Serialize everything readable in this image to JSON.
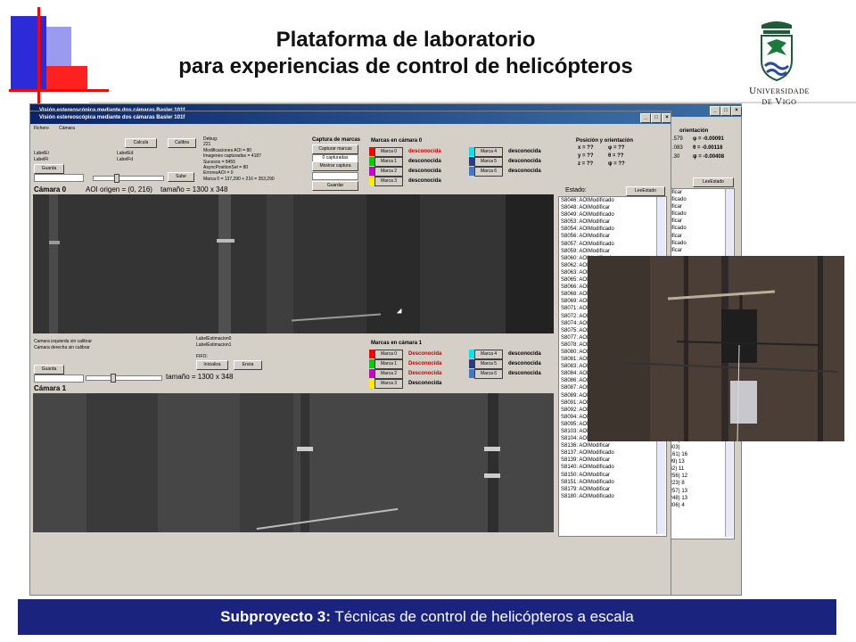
{
  "slide": {
    "title_line1": "Plataforma de laboratorio",
    "title_line2": "para experiencias de control de helicópteros",
    "university_line1": "Universidade",
    "university_line2": "de Vigo",
    "footer_bold": "Subproyecto 3:",
    "footer_text": " Técnicas de control de helicópteros a escala",
    "colors": {
      "footer_bg": "#1a237e",
      "deco_red": "#ff0000",
      "deco_blue": "#2b2bd8"
    }
  },
  "window": {
    "title": "Visión estereoscópica mediante dos cámaras Basler 101f",
    "title_back": "Visión estereoscópica mediante dos cámaras Basler 101f",
    "menu": [
      "Fichero",
      "Cámara"
    ],
    "controls": {
      "minimize": "_",
      "maximize": "□",
      "close": "×"
    }
  },
  "cam0": {
    "label_ei": "LabelEi",
    "label_fi": "LabelFi",
    "label_ed": "LabelEd",
    "label_fd": "LabelFd",
    "calcula": "Calcula",
    "calibra": "Calibra",
    "guarda": "Guarda",
    "sube": "Sube",
    "debug_lines": [
      "Debug:",
      "221",
      "Modificaciones AOI = 80",
      "Imagenes capturadas = 4187",
      "Sucesos = 8455",
      "AsyncPositionSet = 80",
      "ErroresAOI = 0",
      "Marca 0 = 137,290 + 216 = 353,290"
    ],
    "caption": "Cámara 0",
    "aoi": "AOI origen = (0, 216)",
    "size": "tamaño = 1300 x 348"
  },
  "capture": {
    "title": "Captura de marcas",
    "capturar": "Capturar marcas",
    "count": "0 capturadas",
    "mostrar": "Mostrar captura",
    "guardar": "Guardar"
  },
  "markers0": {
    "title": "Marcas en cámara 0",
    "items": [
      {
        "label": "Marca 0",
        "status": "desconocida",
        "color": "#ff0000",
        "status_color": "#cc0000"
      },
      {
        "label": "Marca 1",
        "status": "desconocida",
        "color": "#00cc00",
        "status_color": "#000000"
      },
      {
        "label": "Marca 2",
        "status": "desconocida",
        "color": "#cc00cc",
        "status_color": "#000000"
      },
      {
        "label": "Marca 3",
        "status": "desconocida",
        "color": "#ffee00",
        "status_color": "#000000"
      },
      {
        "label": "Marca 4",
        "status": "desconocida",
        "color": "#00e5ee",
        "status_color": "#000000"
      },
      {
        "label": "Marca 5",
        "status": "desconocida",
        "color": "#2a3a8a",
        "status_color": "#000000"
      },
      {
        "label": "Marca 6",
        "status": "desconocida",
        "color": "#4477cc",
        "status_color": "#000000"
      }
    ]
  },
  "pose": {
    "title": "Posición y orientación",
    "x": "x = ??",
    "y": "y = ??",
    "z": "z = ??",
    "phi": "φ = ??",
    "theta": "θ = ??",
    "psi": "ψ = ??",
    "back_title": "orientación",
    "back_lines": [
      ".579",
      ".083",
      ".30"
    ],
    "back_vals": [
      "φ = -0.00091",
      "θ = -0.00116",
      "ψ = -0.00408"
    ]
  },
  "estado": {
    "label": "Estado:",
    "button": "LeeEstado",
    "back_button": "LeeEstado",
    "lines": [
      "S8046: AOIModificado",
      "S8048: AOIModificar",
      "S8049: AOIModificado",
      "S8053: AOIModificar",
      "S8054: AOIModificado",
      "S8056: AOIModificar",
      "S8057: AOIModificado",
      "S8059: AOIModificar",
      "S8060: AOIModificado",
      "S8062: AOIModificar",
      "S8063: AOIModificado",
      "S8065: AOIModificar",
      "S8066: AOIModificado",
      "S8068: AOIModificar",
      "S8069: AOIModificado",
      "S8071: AOIModificar",
      "S8072: AOIModificado",
      "S8074: AOIModificar",
      "S8075: AOIModificado",
      "S8077: AOIModificar",
      "S8078: AOIModificado",
      "S8080: AOIModificar",
      "S8081: AOIModificado",
      "S8083: AOIModificar",
      "S8084: AOIModificado",
      "S8086: AOIModificar",
      "S8087: AOIModificado",
      "S8089: AOIModificar",
      "S8091: AOIModificado",
      "S8092: AOIModificar",
      "S8094: AOIModificado",
      "S8095: AOIModificar",
      "S8103: AOIModificado",
      "S8104: AOIModificar",
      "S8136: AOIModificar",
      "S8137: AOIModificado",
      "S8139: AOIModificar",
      "S8140: AOIModificado",
      "S8150: AOIModificar",
      "S8151: AOIModificado",
      "S8179: AOIModificar",
      "S8180: AOIModificado"
    ],
    "back_lines": [
      "dificar",
      "dificado",
      "dificar",
      "dificado",
      "dificar",
      "dificado",
      "dificar",
      "dificado",
      "dificar"
    ],
    "back_lines_bottom": [
      ",266)",
      ",303)",
      ",161) 16",
      ",99) 13",
      ",62) 11",
      ",256) 12",
      ",223) 8",
      ",257) 13",
      ",248) 13",
      ",306) 4"
    ]
  },
  "cam1": {
    "status_left": "Camara izquierda sin calibrar",
    "status_right": "Camara derecha sin calibrar",
    "estim0": "LabelEstimacion0",
    "estim1": "LabelEstimacion1",
    "fifo": "FIFO:",
    "inicializa": "Inicializa",
    "envia": "Envia",
    "guarda": "Guarda",
    "size": "tamaño = 1300 x 348",
    "caption": "Cámara 1"
  },
  "markers1": {
    "title": "Marcas en cámara 1",
    "items": [
      {
        "label": "Marca 0",
        "status": "Desconocida",
        "color": "#ff0000",
        "status_color": "#cc0000"
      },
      {
        "label": "Marca 1",
        "status": "Desconocida",
        "color": "#00cc00",
        "status_color": "#cc0000"
      },
      {
        "label": "Marca 2",
        "status": "Desconocida",
        "color": "#cc00cc",
        "status_color": "#cc0000"
      },
      {
        "label": "Marca 3",
        "status": "Desconocida",
        "color": "#ffee00",
        "status_color": "#000000"
      },
      {
        "label": "Marca 4",
        "status": "desconocida",
        "color": "#00e5ee",
        "status_color": "#000000"
      },
      {
        "label": "Marca 5",
        "status": "desconocida",
        "color": "#2a3a8a",
        "status_color": "#000000"
      },
      {
        "label": "Marca 6",
        "status": "desconocida",
        "color": "#4477cc",
        "status_color": "#000000"
      }
    ]
  }
}
